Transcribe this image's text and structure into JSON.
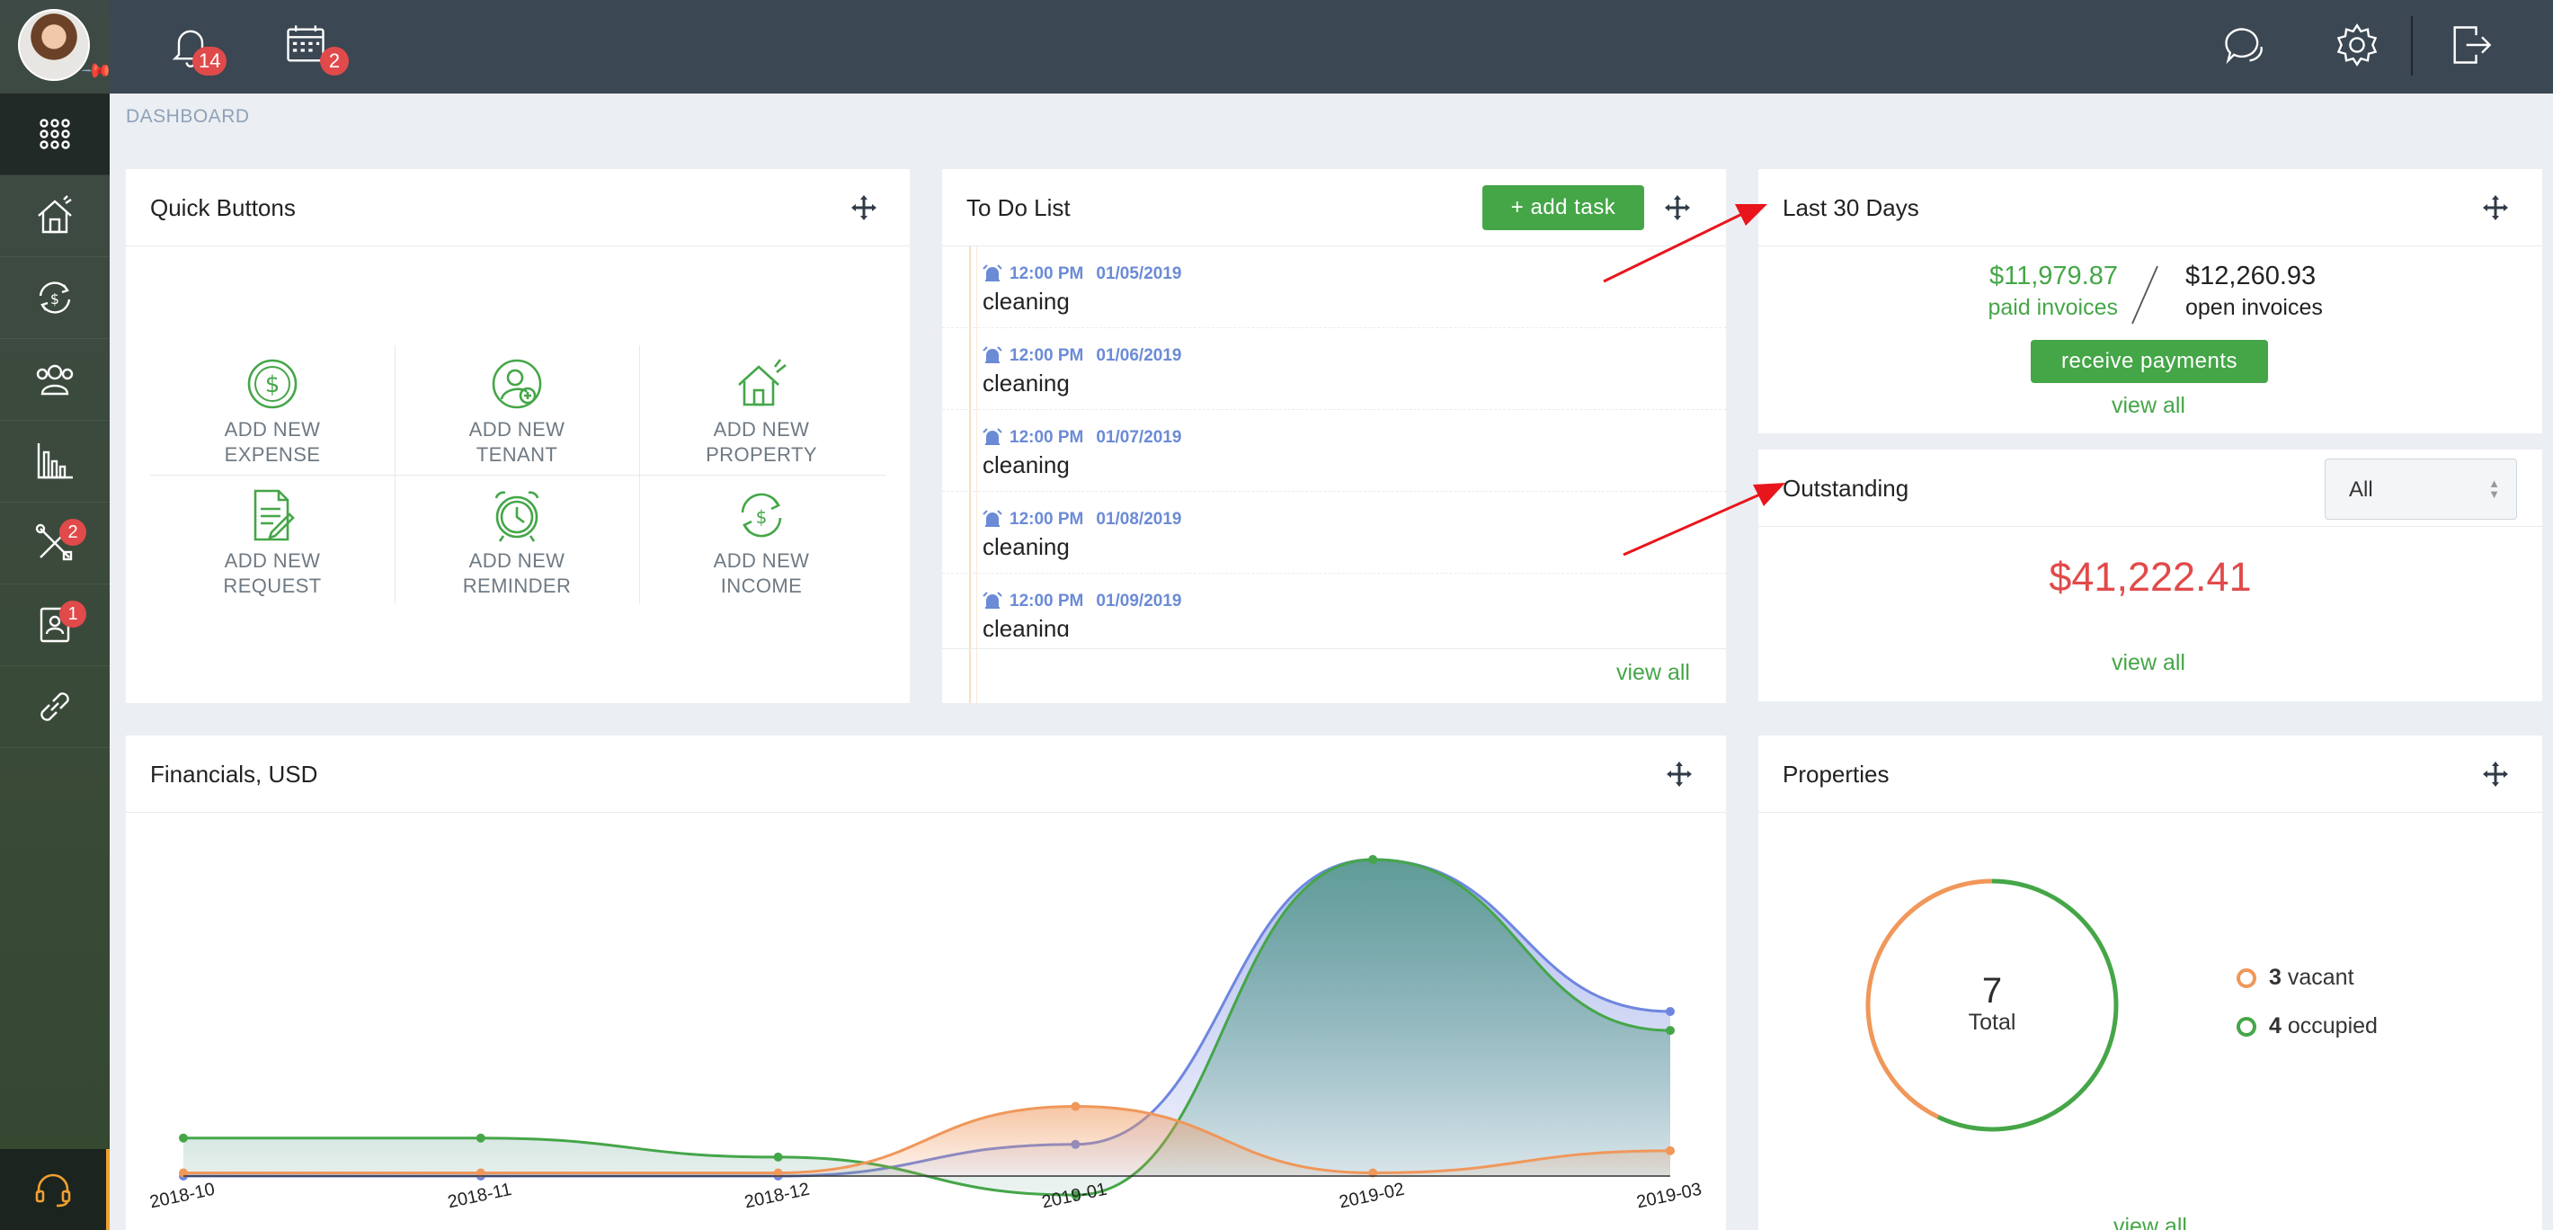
{
  "sidebar": {
    "items": [
      {
        "name": "dashboard",
        "badge": ""
      },
      {
        "name": "properties",
        "badge": ""
      },
      {
        "name": "transactions",
        "badge": ""
      },
      {
        "name": "tenants",
        "badge": ""
      },
      {
        "name": "reports",
        "badge": ""
      },
      {
        "name": "maintenance",
        "badge": "2"
      },
      {
        "name": "applicants",
        "badge": "1"
      },
      {
        "name": "integrations",
        "badge": ""
      }
    ]
  },
  "topbar": {
    "notifications_count": "14",
    "calendar_count": "2"
  },
  "breadcrumb": "DASHBOARD",
  "quick_buttons": {
    "title": "Quick Buttons",
    "items": [
      {
        "line1": "ADD NEW",
        "line2": "EXPENSE",
        "icon": "dollar-circle-icon"
      },
      {
        "line1": "ADD NEW",
        "line2": "TENANT",
        "icon": "add-user-icon"
      },
      {
        "line1": "ADD NEW",
        "line2": "PROPERTY",
        "icon": "house-icon"
      },
      {
        "line1": "ADD NEW",
        "line2": "REQUEST",
        "icon": "document-edit-icon"
      },
      {
        "line1": "ADD NEW",
        "line2": "REMINDER",
        "icon": "alarm-clock-icon"
      },
      {
        "line1": "ADD NEW",
        "line2": "INCOME",
        "icon": "money-cycle-icon"
      }
    ]
  },
  "todo": {
    "title": "To Do List",
    "add_label": "+ add task",
    "view_all": "view all",
    "items": [
      {
        "time": "12:00 PM",
        "date": "01/05/2019",
        "text": "cleaning"
      },
      {
        "time": "12:00 PM",
        "date": "01/06/2019",
        "text": "cleaning"
      },
      {
        "time": "12:00 PM",
        "date": "01/07/2019",
        "text": "cleaning"
      },
      {
        "time": "12:00 PM",
        "date": "01/08/2019",
        "text": "cleaning"
      },
      {
        "time": "12:00 PM",
        "date": "01/09/2019",
        "text": "cleaning"
      }
    ]
  },
  "last30": {
    "title": "Last 30 Days",
    "paid_amount": "$11,979.87",
    "paid_label": "paid invoices",
    "open_amount": "$12,260.93",
    "open_label": "open invoices",
    "button": "receive payments",
    "view_all": "view all"
  },
  "outstanding": {
    "title": "Outstanding",
    "filter": "All",
    "amount": "$41,222.41",
    "view_all": "view all"
  },
  "financials": {
    "title": "Financials, USD"
  },
  "properties": {
    "title": "Properties",
    "total": "7",
    "total_label": "Total",
    "vacant_count": "3",
    "vacant_label": "vacant",
    "occupied_count": "4",
    "occupied_label": "occupied",
    "vacant_fraction": 0.4286,
    "colors": {
      "vacant": "#f0975a",
      "occupied": "#45a648"
    },
    "footer_partial": "view all"
  },
  "chart_data": {
    "type": "area",
    "categories": [
      "2018-10",
      "2018-11",
      "2018-12",
      "2019-01",
      "2019-02",
      "2019-03"
    ],
    "series": [
      {
        "color": "#45a648",
        "values": [
          12,
          12,
          6,
          -6,
          100,
          46
        ]
      },
      {
        "color": "#6f86e0",
        "values": [
          0,
          0,
          0,
          10,
          100,
          52
        ]
      },
      {
        "color": "#f0975a",
        "values": [
          1,
          1,
          1,
          22,
          1,
          8
        ]
      }
    ]
  }
}
